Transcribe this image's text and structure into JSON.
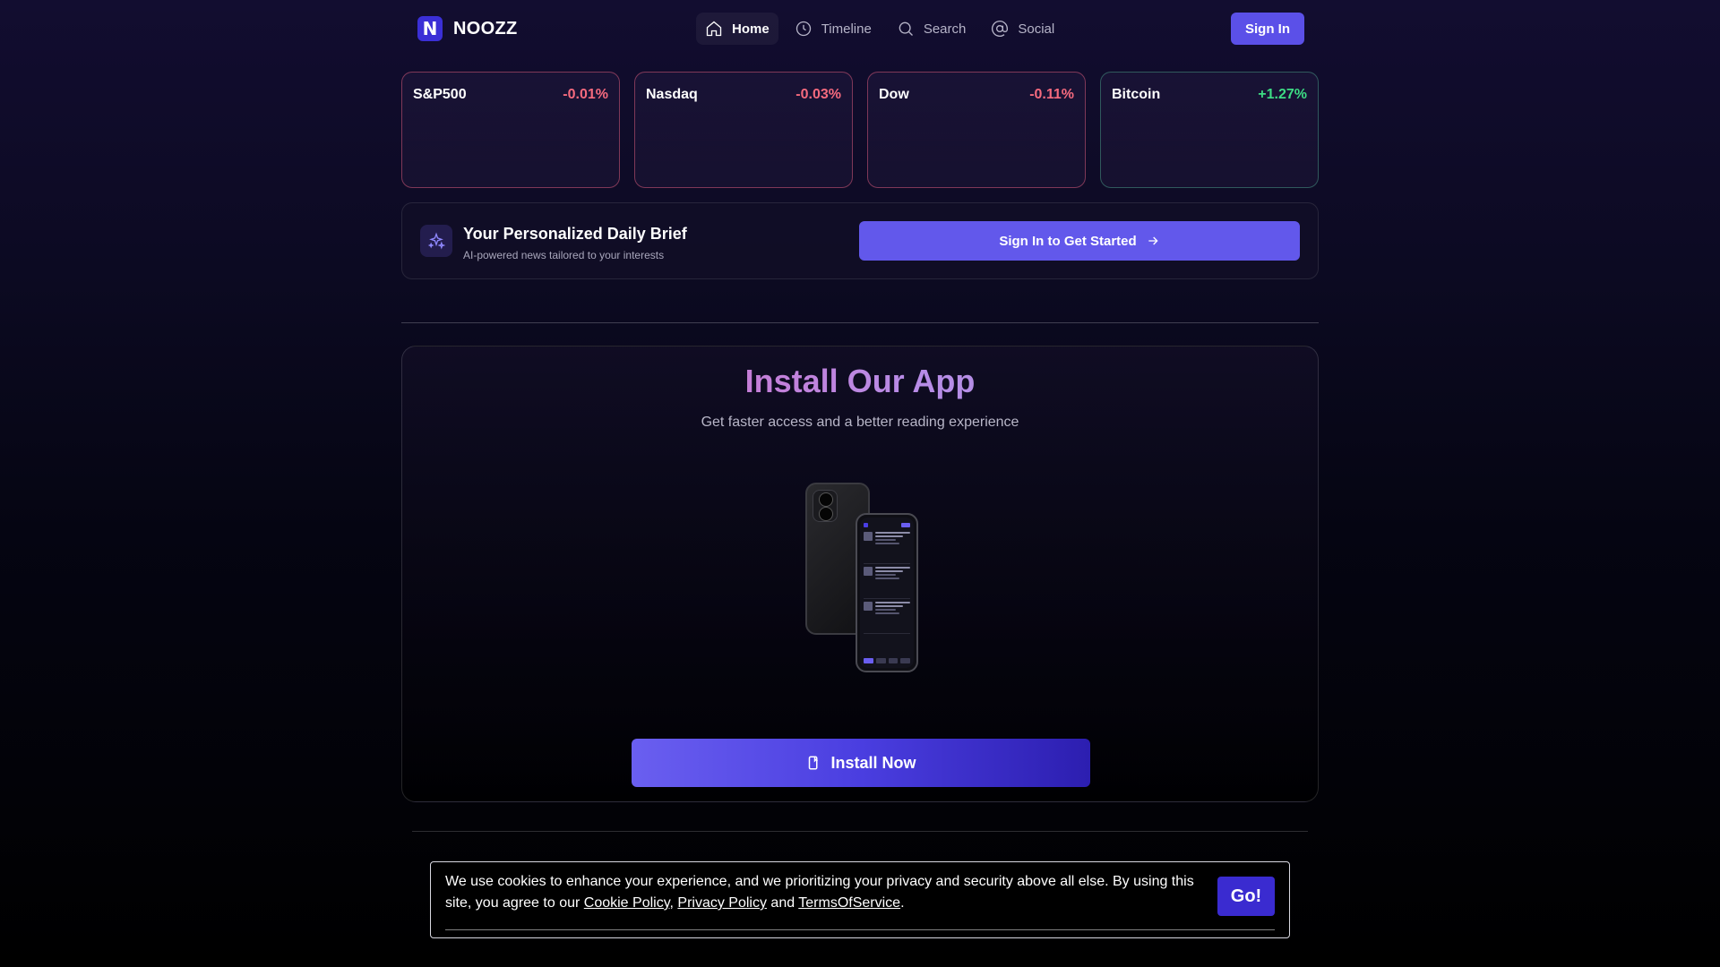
{
  "nav": {
    "brand": "NOOZZ",
    "brand_mark": "N",
    "links": [
      {
        "label": "Home",
        "icon": "home-icon",
        "active": true
      },
      {
        "label": "Timeline",
        "icon": "clock-icon",
        "active": false
      },
      {
        "label": "Search",
        "icon": "search-icon",
        "active": false
      },
      {
        "label": "Social",
        "icon": "at-icon",
        "active": false
      }
    ],
    "sign_in": "Sign In"
  },
  "tickers": [
    {
      "name": "S&P500",
      "change": "-0.01%",
      "direction": "down"
    },
    {
      "name": "Nasdaq",
      "change": "-0.03%",
      "direction": "down"
    },
    {
      "name": "Dow",
      "change": "-0.11%",
      "direction": "down"
    },
    {
      "name": "Bitcoin",
      "change": "+1.27%",
      "direction": "up"
    }
  ],
  "brief": {
    "title": "Your Personalized Daily Brief",
    "subtitle": "AI-powered news tailored to your interests",
    "button": "Sign In to Get Started",
    "icon": "sparkles-icon"
  },
  "install": {
    "title": "Install Our App",
    "subtitle": "Get faster access and a better reading experience",
    "button": "Install Now",
    "button_icon": "phone-install-icon"
  },
  "cookie": {
    "text_before": "We use cookies to enhance your experience, and we prioritizing your privacy and security above all else. By using this site, you agree to our ",
    "cookie_policy": "Cookie Policy",
    "sep1": ", ",
    "privacy_policy": "Privacy Policy",
    "sep2": " and ",
    "terms": "TermsOfService",
    "text_after": ".",
    "button": "Go!"
  },
  "colors": {
    "accent": "#5b50e8",
    "negative": "#f56a7e",
    "positive": "#3ddc84"
  }
}
